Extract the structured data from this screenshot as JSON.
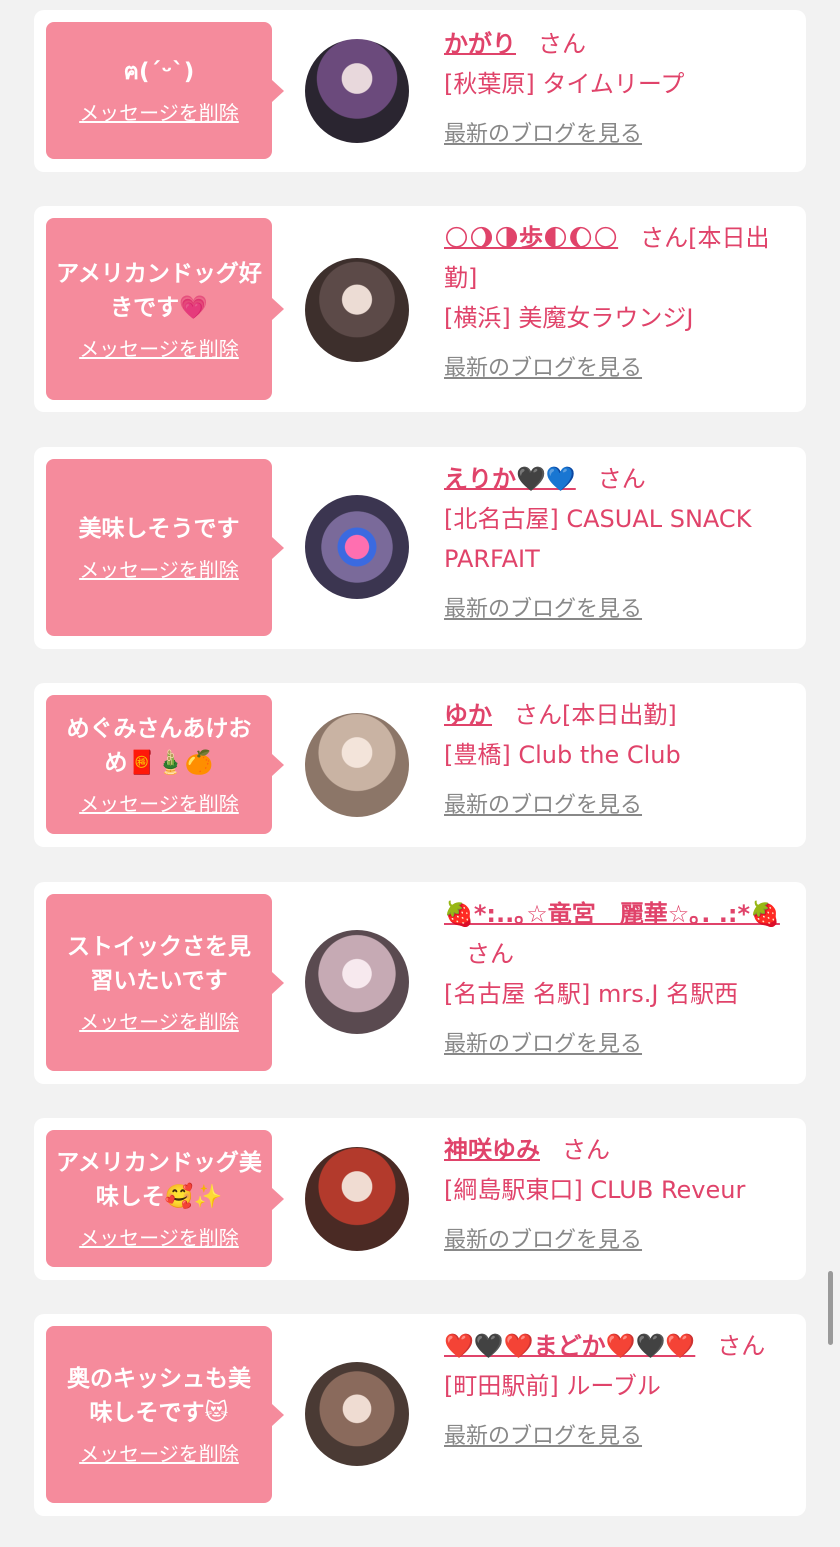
{
  "common": {
    "delete_label": "メッセージを削除",
    "san": "さん",
    "blog_label": "最新のブログを見る"
  },
  "items": [
    {
      "message": "ฅ(ˊᵕˋ)",
      "name": "かがり",
      "suffix": "",
      "shop": "[秋葉原] タイムリープ",
      "avatar_colors": [
        "#2a2530",
        "#6b4a7c",
        "#c8b6c0"
      ]
    },
    {
      "message": "アメリカンドッグ好きです💗",
      "name": "🌕🌖🌗歩🌓🌔🌕",
      "suffix": "[本日出勤]",
      "shop": "[横浜] 美魔女ラウンジJ",
      "avatar_colors": [
        "#3d2f2c",
        "#6a5a55",
        "#d9c9c0"
      ]
    },
    {
      "message": "美味しそうです",
      "name": "えりか🖤💙",
      "suffix": "",
      "shop": "[北名古屋] CASUAL SNACK PARFAIT",
      "avatar_colors": [
        "#3b3550",
        "#7a6a9a",
        "#e8d8f0"
      ]
    },
    {
      "message": "めぐみさんあけおめ🧧🎍🍊",
      "name": "ゆか",
      "suffix": "[本日出勤]",
      "shop": "[豊橋] Club the Club",
      "avatar_colors": [
        "#8c7668",
        "#c9b3a3",
        "#eadbd0"
      ]
    },
    {
      "message": "ストイックさを見習いたいです",
      "name": "🍓*:..｡☆竜宮　麗華☆｡. .:*🍓",
      "suffix": "",
      "shop": "[名古屋 名駅] mrs.J 名駅西",
      "avatar_colors": [
        "#5a4a50",
        "#c6aab4",
        "#f1e2e6"
      ]
    },
    {
      "message": "アメリカンドッグ美味しそ🥰✨",
      "name": "神咲ゆみ",
      "suffix": "",
      "shop": "[綱島駅東口] CLUB Reveur",
      "avatar_colors": [
        "#4a2a24",
        "#b33a2c",
        "#e9d3c8"
      ]
    },
    {
      "message": "奥のキッシュも美味しそです😻",
      "name": "❤️🖤❤️まどか❤️🖤❤️",
      "suffix": "",
      "shop": "[町田駅前] ルーブル",
      "avatar_colors": [
        "#4a3a34",
        "#8a6a5c",
        "#e2cfc4"
      ]
    }
  ]
}
